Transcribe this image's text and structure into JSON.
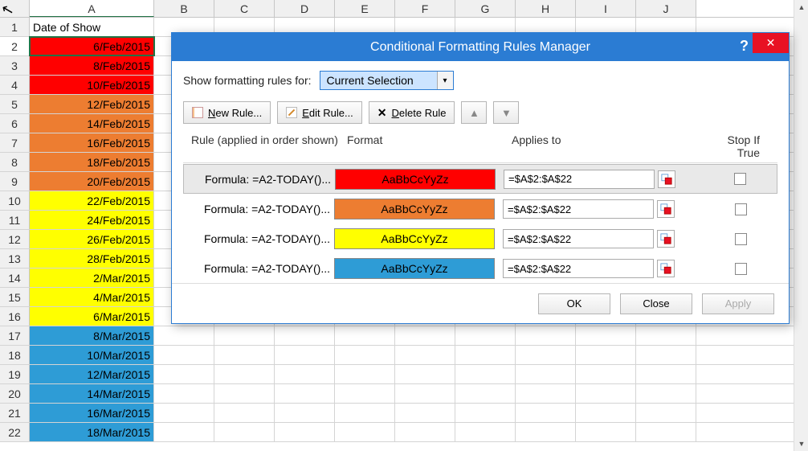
{
  "spreadsheet": {
    "columns": [
      "A",
      "B",
      "C",
      "D",
      "E",
      "F",
      "G",
      "H",
      "I",
      "J"
    ],
    "header_label": "Date of Show",
    "active_row": 2,
    "rows": [
      {
        "n": 1,
        "val": "Date of Show",
        "bg": "",
        "hdr": true
      },
      {
        "n": 2,
        "val": "6/Feb/2015",
        "bg": "red",
        "sel": true
      },
      {
        "n": 3,
        "val": "8/Feb/2015",
        "bg": "red"
      },
      {
        "n": 4,
        "val": "10/Feb/2015",
        "bg": "red"
      },
      {
        "n": 5,
        "val": "12/Feb/2015",
        "bg": "orange"
      },
      {
        "n": 6,
        "val": "14/Feb/2015",
        "bg": "orange"
      },
      {
        "n": 7,
        "val": "16/Feb/2015",
        "bg": "orange"
      },
      {
        "n": 8,
        "val": "18/Feb/2015",
        "bg": "orange"
      },
      {
        "n": 9,
        "val": "20/Feb/2015",
        "bg": "orange"
      },
      {
        "n": 10,
        "val": "22/Feb/2015",
        "bg": "yellow"
      },
      {
        "n": 11,
        "val": "24/Feb/2015",
        "bg": "yellow"
      },
      {
        "n": 12,
        "val": "26/Feb/2015",
        "bg": "yellow"
      },
      {
        "n": 13,
        "val": "28/Feb/2015",
        "bg": "yellow"
      },
      {
        "n": 14,
        "val": "2/Mar/2015",
        "bg": "yellow"
      },
      {
        "n": 15,
        "val": "4/Mar/2015",
        "bg": "yellow"
      },
      {
        "n": 16,
        "val": "6/Mar/2015",
        "bg": "yellow"
      },
      {
        "n": 17,
        "val": "8/Mar/2015",
        "bg": "blue"
      },
      {
        "n": 18,
        "val": "10/Mar/2015",
        "bg": "blue"
      },
      {
        "n": 19,
        "val": "12/Mar/2015",
        "bg": "blue"
      },
      {
        "n": 20,
        "val": "14/Mar/2015",
        "bg": "blue"
      },
      {
        "n": 21,
        "val": "16/Mar/2015",
        "bg": "blue"
      },
      {
        "n": 22,
        "val": "18/Mar/2015",
        "bg": "blue"
      }
    ]
  },
  "dialog": {
    "title": "Conditional Formatting Rules Manager",
    "show_rules_label": "Show formatting rules for:",
    "dropdown_value": "Current Selection",
    "toolbar": {
      "new": "New Rule...",
      "edit": "Edit Rule...",
      "delete": "Delete Rule"
    },
    "headers": {
      "rule": "Rule (applied in order shown)",
      "format": "Format",
      "applies": "Applies to",
      "stop": "Stop If True"
    },
    "sample_text": "AaBbCcYyZz",
    "rules": [
      {
        "formula": "Formula: =A2-TODAY()...",
        "color": "red",
        "applies": "=$A$2:$A$22",
        "selected": true
      },
      {
        "formula": "Formula: =A2-TODAY()...",
        "color": "orange",
        "applies": "=$A$2:$A$22"
      },
      {
        "formula": "Formula: =A2-TODAY()...",
        "color": "yellow",
        "applies": "=$A$2:$A$22"
      },
      {
        "formula": "Formula: =A2-TODAY()...",
        "color": "blue",
        "applies": "=$A$2:$A$22"
      }
    ],
    "footer": {
      "ok": "OK",
      "close": "Close",
      "apply": "Apply"
    }
  }
}
